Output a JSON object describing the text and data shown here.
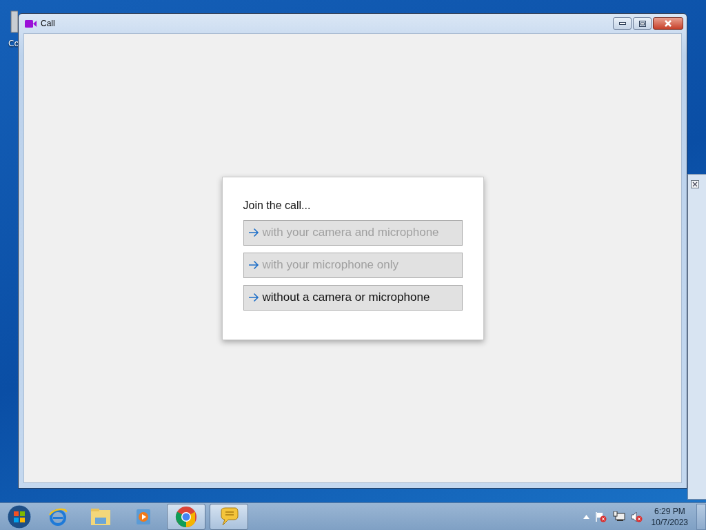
{
  "desktop": {
    "icons": [
      {
        "label": "Co"
      }
    ]
  },
  "window": {
    "title": "Call",
    "prompt": "Join the call...",
    "options": [
      {
        "label": "with your camera and microphone",
        "disabled": true
      },
      {
        "label": "with your microphone only",
        "disabled": true
      },
      {
        "label": "without a camera or microphone",
        "disabled": false
      }
    ]
  },
  "taskbar": {
    "apps": [
      {
        "kind": "ie",
        "active": false
      },
      {
        "kind": "folder",
        "active": false
      },
      {
        "kind": "media",
        "active": false
      },
      {
        "kind": "chrome",
        "active": true
      },
      {
        "kind": "chat",
        "active": true
      }
    ],
    "time": "6:29 PM",
    "date": "10/7/2023"
  }
}
